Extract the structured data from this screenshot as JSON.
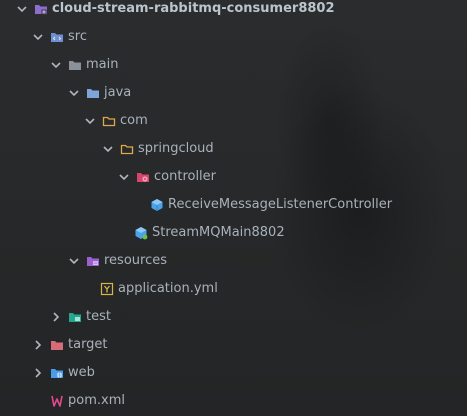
{
  "tree": {
    "root": {
      "label": "cloud-stream-rabbitmq-consumer8802",
      "icon": "module-folder-icon"
    },
    "src": {
      "label": "src",
      "icon": "source-root-folder-icon"
    },
    "main": {
      "label": "main",
      "icon": "folder-icon"
    },
    "java": {
      "label": "java",
      "icon": "java-source-folder-icon"
    },
    "com": {
      "label": "com",
      "icon": "package-icon"
    },
    "springcloud": {
      "label": "springcloud",
      "icon": "package-icon"
    },
    "controller": {
      "label": "controller",
      "icon": "controller-package-icon"
    },
    "receive_controller": {
      "label": "ReceiveMessageListenerController",
      "icon": "java-class-icon"
    },
    "stream_main": {
      "label": "StreamMQMain8802",
      "icon": "spring-boot-class-icon"
    },
    "resources": {
      "label": "resources",
      "icon": "resources-folder-icon"
    },
    "application_yml": {
      "label": "application.yml",
      "icon": "yaml-file-icon"
    },
    "test": {
      "label": "test",
      "icon": "test-folder-icon"
    },
    "target": {
      "label": "target",
      "icon": "excluded-folder-icon"
    },
    "web": {
      "label": "web",
      "icon": "web-folder-icon"
    },
    "pom_xml": {
      "label": "pom.xml",
      "icon": "maven-icon"
    }
  },
  "colors": {
    "text": "#a9b1ba",
    "folder_gray": "#8a9199",
    "folder_blue": "#7fa4d8",
    "package_orange": "#e0a84a",
    "controller_red": "#d6456b",
    "class_blue": "#4aa3e8",
    "resources_purple": "#9c5fd0",
    "yaml_yellow": "#d6b64a",
    "test_green": "#27a590",
    "target_red": "#d56c78",
    "web_blue": "#4a9be8",
    "maven_pink": "#e04a8c"
  }
}
